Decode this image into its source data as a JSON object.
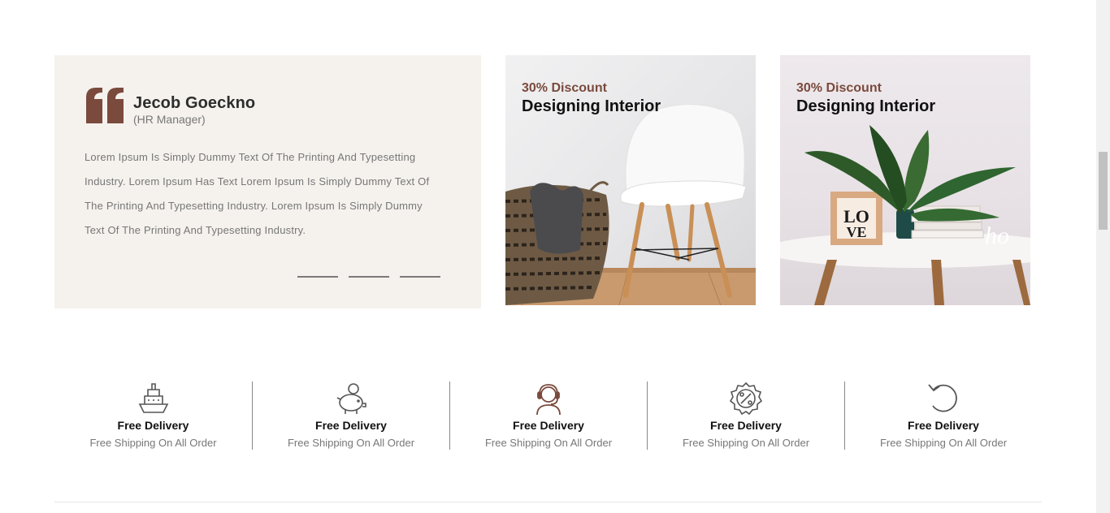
{
  "testimonial": {
    "name": "Jecob Goeckno",
    "role": "(HR Manager)",
    "text": "Lorem Ipsum Is Simply Dummy Text Of The Printing And Typesetting Industry. Lorem Ipsum Has Text Lorem Ipsum Is Simply Dummy Text Of The Printing And Typesetting Industry. Lorem Ipsum Is Simply Dummy Text Of The Printing And Typesetting Industry.",
    "slides": 3,
    "accent_color": "#7a4a3d"
  },
  "banners": [
    {
      "discount": "30% Discount",
      "title": "Designing Interior",
      "image": "chair-basket"
    },
    {
      "discount": "30% Discount",
      "title": "Designing Interior",
      "image": "plant-table"
    }
  ],
  "features": [
    {
      "icon": "ship-icon",
      "title": "Free Delivery",
      "subtitle": "Free Shipping On All Order"
    },
    {
      "icon": "piggy-bank-icon",
      "title": "Free Delivery",
      "subtitle": "Free Shipping On All Order"
    },
    {
      "icon": "support-headset-icon",
      "title": "Free Delivery",
      "subtitle": "Free Shipping On All Order"
    },
    {
      "icon": "discount-badge-icon",
      "title": "Free Delivery",
      "subtitle": "Free Shipping On All Order"
    },
    {
      "icon": "return-arrow-icon",
      "title": "Free Delivery",
      "subtitle": "Free Shipping On All Order"
    }
  ]
}
